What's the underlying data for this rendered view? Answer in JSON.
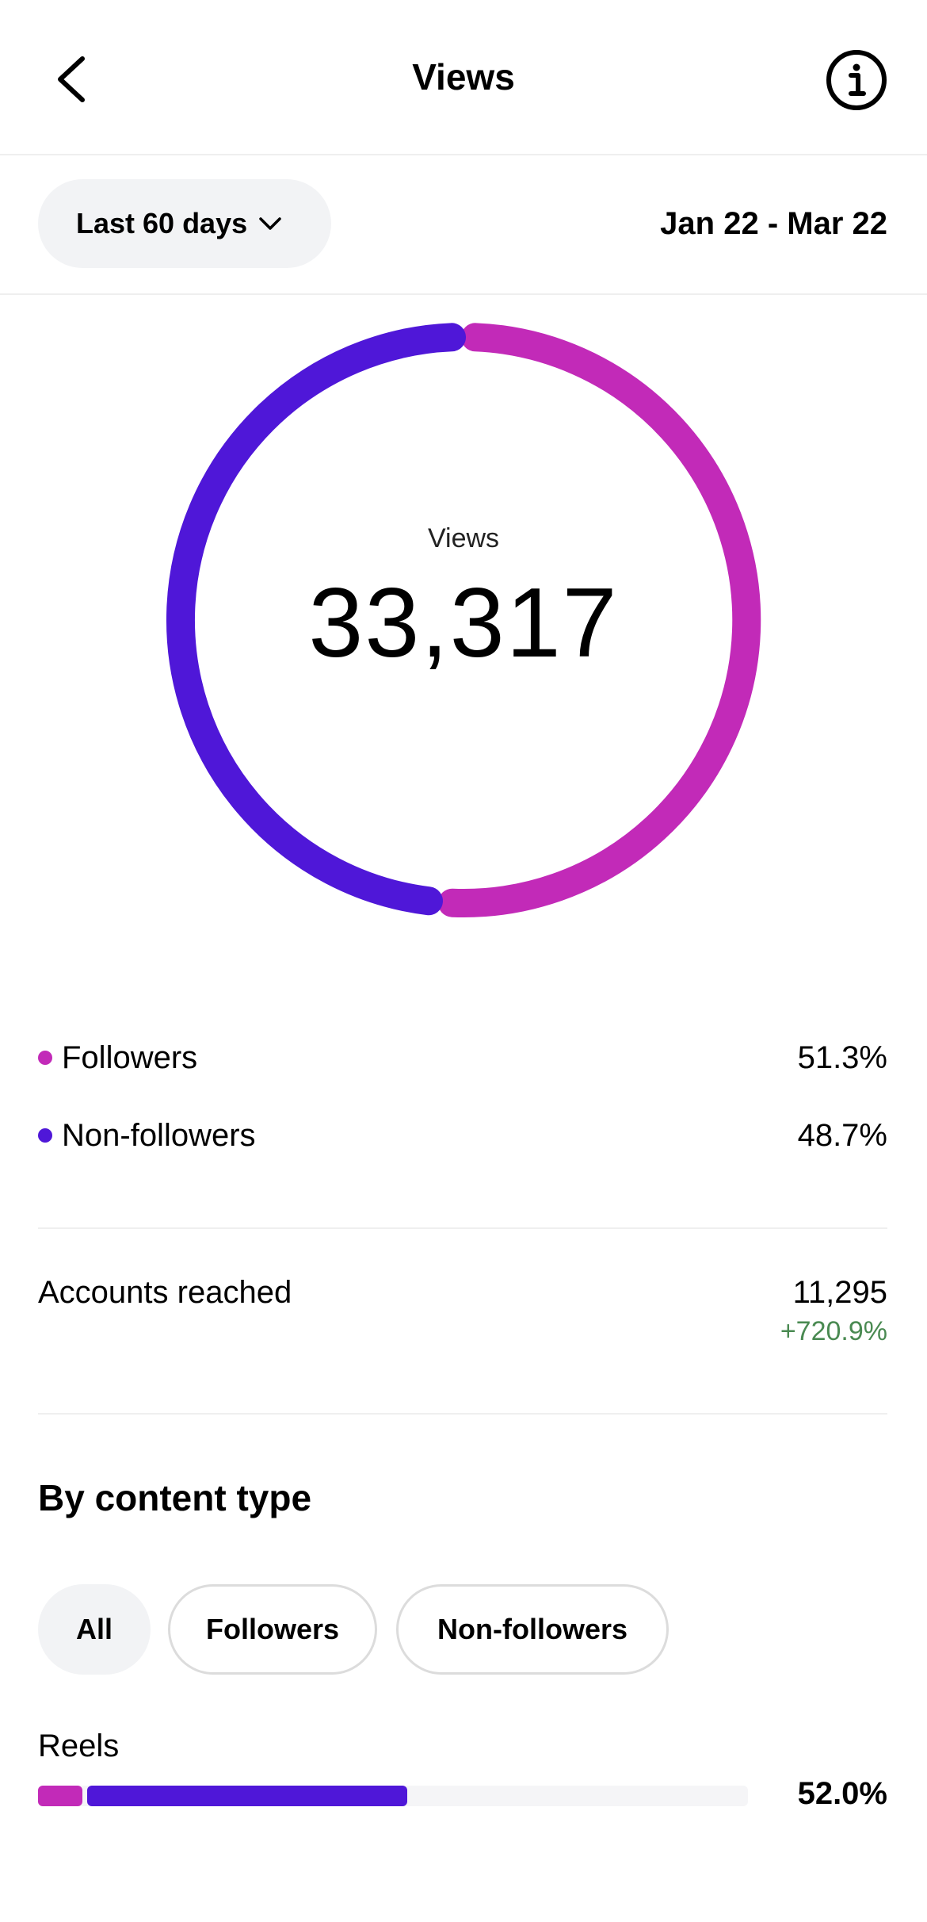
{
  "header": {
    "title": "Views"
  },
  "range": {
    "selected": "Last 60 days",
    "dates": "Jan 22 - Mar 22"
  },
  "summary": {
    "label": "Views",
    "value": "33,317"
  },
  "audience": [
    {
      "label": "Followers",
      "percent": "51.3%",
      "fraction": 0.513,
      "color": "#c22ab8"
    },
    {
      "label": "Non-followers",
      "percent": "48.7%",
      "fraction": 0.487,
      "color": "#4f17d8"
    }
  ],
  "reach": {
    "label": "Accounts reached",
    "value": "11,295",
    "change": "+720.9%"
  },
  "content_type": {
    "title": "By content type",
    "filters": [
      "All",
      "Followers",
      "Non-followers"
    ],
    "rows": [
      {
        "label": "Reels",
        "percent": "52.0%",
        "followers_fraction": 0.062,
        "nonfollowers_fraction": 0.458
      }
    ]
  },
  "colors": {
    "followers": "#c22ab8",
    "non_followers": "#4f17d8",
    "positive": "#4a8a52"
  },
  "icons": {
    "back": "chevron-left-icon",
    "info": "info-circle-icon",
    "dropdown": "chevron-down-icon"
  }
}
